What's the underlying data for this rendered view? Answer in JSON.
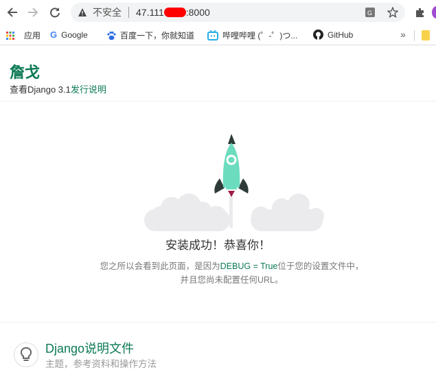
{
  "browser": {
    "security_label": "不安全",
    "address_visible_start": "47.111",
    "address_visible_end": ":8000",
    "bookmarks": [
      {
        "label": "应用",
        "icon": "apps-grid-icon"
      },
      {
        "label": "Google",
        "icon": "google-icon"
      },
      {
        "label": "百度一下，你就知道",
        "icon": "baidu-paw-icon"
      },
      {
        "label": "哔哩哔哩 (゜-゜)つ...",
        "icon": "bilibili-tv-icon"
      },
      {
        "label": "GitHub",
        "icon": "github-icon"
      }
    ],
    "overflow_label": "»"
  },
  "header": {
    "title": "詹戈",
    "subtitle_prefix": "查看Django 3.1",
    "subtitle_link": "发行说明"
  },
  "main": {
    "heading": "安装成功！恭喜你！",
    "text_before": "您之所以会看到此页面，是因为",
    "text_code": "DEBUG = True",
    "text_after": "位于您的设置文件中，并且您尚未配置任何URL。"
  },
  "footer": {
    "docs_title": "Django说明文件",
    "docs_sub": "主题，参考资料和操作方法"
  },
  "colors": {
    "accent": "#0c7a55",
    "rocket": "#6cdcbf",
    "fins": "#2e3b38",
    "flame": "#a01c45"
  }
}
